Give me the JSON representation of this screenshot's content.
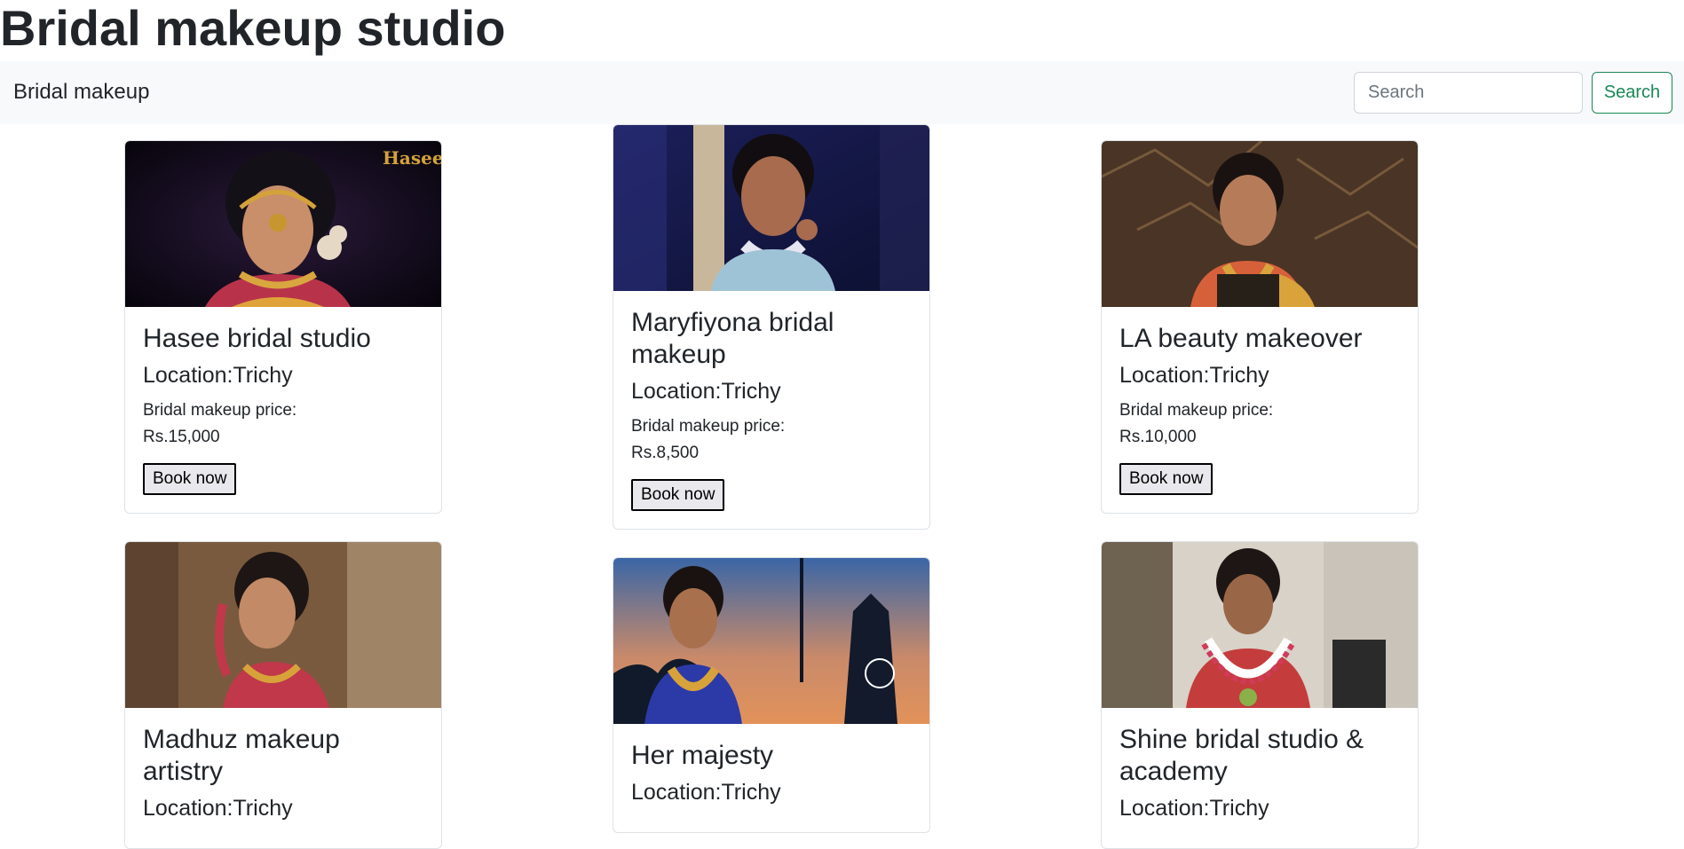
{
  "page": {
    "title": "Bridal makeup studio"
  },
  "navbar": {
    "brand": "Bridal makeup",
    "search_placeholder": "Search",
    "search_button": "Search"
  },
  "cards": [
    {
      "title": "Hasee bridal studio",
      "location": "Location:Trichy",
      "price_label": "Bridal makeup price:",
      "price_value": "Rs.15,000",
      "button": "Book now",
      "watermark": "Hasee"
    },
    {
      "title": "Maryfiyona bridal makeup",
      "location": "Location:Trichy",
      "price_label": "Bridal makeup price:",
      "price_value": "Rs.8,500",
      "button": "Book now"
    },
    {
      "title": "LA beauty makeover",
      "location": "Location:Trichy",
      "price_label": "Bridal makeup price:",
      "price_value": "Rs.10,000",
      "button": "Book now"
    },
    {
      "title": "Madhuz makeup artistry",
      "location": "Location:Trichy"
    },
    {
      "title": "Her majesty",
      "location": "Location:Trichy"
    },
    {
      "title": "Shine bridal studio & academy",
      "location": "Location:Trichy"
    }
  ]
}
